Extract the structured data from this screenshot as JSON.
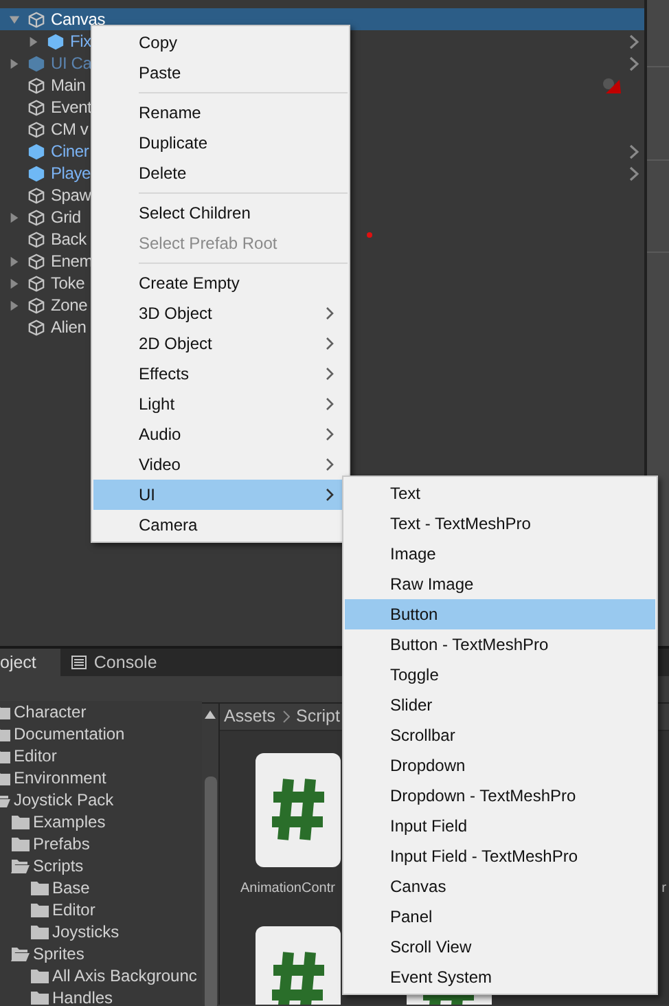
{
  "hierarchy": {
    "items": [
      {
        "name": "Canvas",
        "kind": "object",
        "active": true,
        "selected": true,
        "expanded": true,
        "children": [
          {
            "name": "Fix",
            "kind": "prefab",
            "active": true,
            "selected": false,
            "expanded": false
          }
        ]
      },
      {
        "name": "UI Ca",
        "kind": "prefab",
        "active": false,
        "selected": false,
        "expanded": false
      },
      {
        "name": "Main",
        "kind": "object",
        "active": true,
        "selected": false
      },
      {
        "name": "Event",
        "kind": "object",
        "active": true,
        "selected": false
      },
      {
        "name": "CM v",
        "kind": "object",
        "active": true,
        "selected": false
      },
      {
        "name": "Ciner",
        "kind": "prefab",
        "active": true,
        "selected": false
      },
      {
        "name": "Playe",
        "kind": "prefab",
        "active": true,
        "selected": false
      },
      {
        "name": "Spaw",
        "kind": "object",
        "active": true,
        "selected": false
      },
      {
        "name": "Grid",
        "kind": "object",
        "active": true,
        "selected": false,
        "expanded": false
      },
      {
        "name": "Back",
        "kind": "object",
        "active": true,
        "selected": false
      },
      {
        "name": "Enem",
        "kind": "object",
        "active": true,
        "selected": false,
        "expanded": false
      },
      {
        "name": "Toke",
        "kind": "object",
        "active": true,
        "selected": false,
        "expanded": false
      },
      {
        "name": "Zone",
        "kind": "object",
        "active": true,
        "selected": false,
        "expanded": false
      },
      {
        "name": "Alien",
        "kind": "object",
        "active": true,
        "selected": false
      }
    ]
  },
  "context_menu": {
    "items": [
      {
        "kind": "item",
        "label": "Copy",
        "disabled": false,
        "selected": false
      },
      {
        "kind": "item",
        "label": "Paste",
        "disabled": false,
        "selected": false
      },
      {
        "kind": "separator"
      },
      {
        "kind": "item",
        "label": "Rename",
        "disabled": false,
        "selected": false
      },
      {
        "kind": "item",
        "label": "Duplicate",
        "disabled": false,
        "selected": false
      },
      {
        "kind": "item",
        "label": "Delete",
        "disabled": false,
        "selected": false
      },
      {
        "kind": "separator"
      },
      {
        "kind": "item",
        "label": "Select Children",
        "disabled": false,
        "selected": false
      },
      {
        "kind": "item",
        "label": "Select Prefab Root",
        "disabled": true,
        "selected": false
      },
      {
        "kind": "separator"
      },
      {
        "kind": "item",
        "label": "Create Empty",
        "disabled": false,
        "selected": false
      },
      {
        "kind": "submenu",
        "label": "3D Object",
        "disabled": false,
        "selected": false
      },
      {
        "kind": "submenu",
        "label": "2D Object",
        "disabled": false,
        "selected": false
      },
      {
        "kind": "submenu",
        "label": "Effects",
        "disabled": false,
        "selected": false
      },
      {
        "kind": "submenu",
        "label": "Light",
        "disabled": false,
        "selected": false
      },
      {
        "kind": "submenu",
        "label": "Audio",
        "disabled": false,
        "selected": false
      },
      {
        "kind": "submenu",
        "label": "Video",
        "disabled": false,
        "selected": false
      },
      {
        "kind": "submenu",
        "label": "UI",
        "disabled": false,
        "selected": true
      },
      {
        "kind": "item",
        "label": "Camera",
        "disabled": false,
        "selected": false
      }
    ]
  },
  "submenu": {
    "items": [
      {
        "label": "Text",
        "selected": false
      },
      {
        "label": "Text - TextMeshPro",
        "selected": false
      },
      {
        "label": "Image",
        "selected": false
      },
      {
        "label": "Raw Image",
        "selected": false
      },
      {
        "label": "Button",
        "selected": true
      },
      {
        "label": "Button - TextMeshPro",
        "selected": false
      },
      {
        "label": "Toggle",
        "selected": false
      },
      {
        "label": "Slider",
        "selected": false
      },
      {
        "label": "Scrollbar",
        "selected": false
      },
      {
        "label": "Dropdown",
        "selected": false
      },
      {
        "label": "Dropdown - TextMeshPro",
        "selected": false
      },
      {
        "label": "Input Field",
        "selected": false
      },
      {
        "label": "Input Field - TextMeshPro",
        "selected": false
      },
      {
        "label": "Canvas",
        "selected": false
      },
      {
        "label": "Panel",
        "selected": false
      },
      {
        "label": "Scroll View",
        "selected": false
      },
      {
        "label": "Event System",
        "selected": false
      }
    ]
  },
  "panel_tabs": [
    {
      "label": "oject",
      "kind": "plain",
      "selected": true
    },
    {
      "label": "Console",
      "kind": "console",
      "selected": false
    }
  ],
  "project_tree": [
    {
      "name": "Character",
      "expanded": false
    },
    {
      "name": "Documentation",
      "expanded": false
    },
    {
      "name": "Editor",
      "expanded": false
    },
    {
      "name": "Environment",
      "expanded": false
    },
    {
      "name": "Joystick Pack",
      "expanded": true,
      "children": [
        {
          "name": "Examples",
          "expanded": false
        },
        {
          "name": "Prefabs",
          "expanded": false
        },
        {
          "name": "Scripts",
          "expanded": true,
          "children": [
            {
              "name": "Base",
              "expanded": false
            },
            {
              "name": "Editor",
              "expanded": false
            },
            {
              "name": "Joysticks",
              "expanded": false
            }
          ]
        },
        {
          "name": "Sprites",
          "expanded": true,
          "children": [
            {
              "name": "All Axis Backgrounc",
              "expanded": false
            },
            {
              "name": "Handles",
              "expanded": false
            }
          ]
        }
      ]
    }
  ],
  "breadcrumb": [
    "Assets",
    "Script"
  ],
  "assets": [
    {
      "kind": "script",
      "label": "AnimationContr"
    },
    {
      "kind": "slot"
    },
    {
      "kind": "slot",
      "label": "r"
    },
    {
      "kind": "script"
    },
    {
      "kind": "script"
    }
  ]
}
